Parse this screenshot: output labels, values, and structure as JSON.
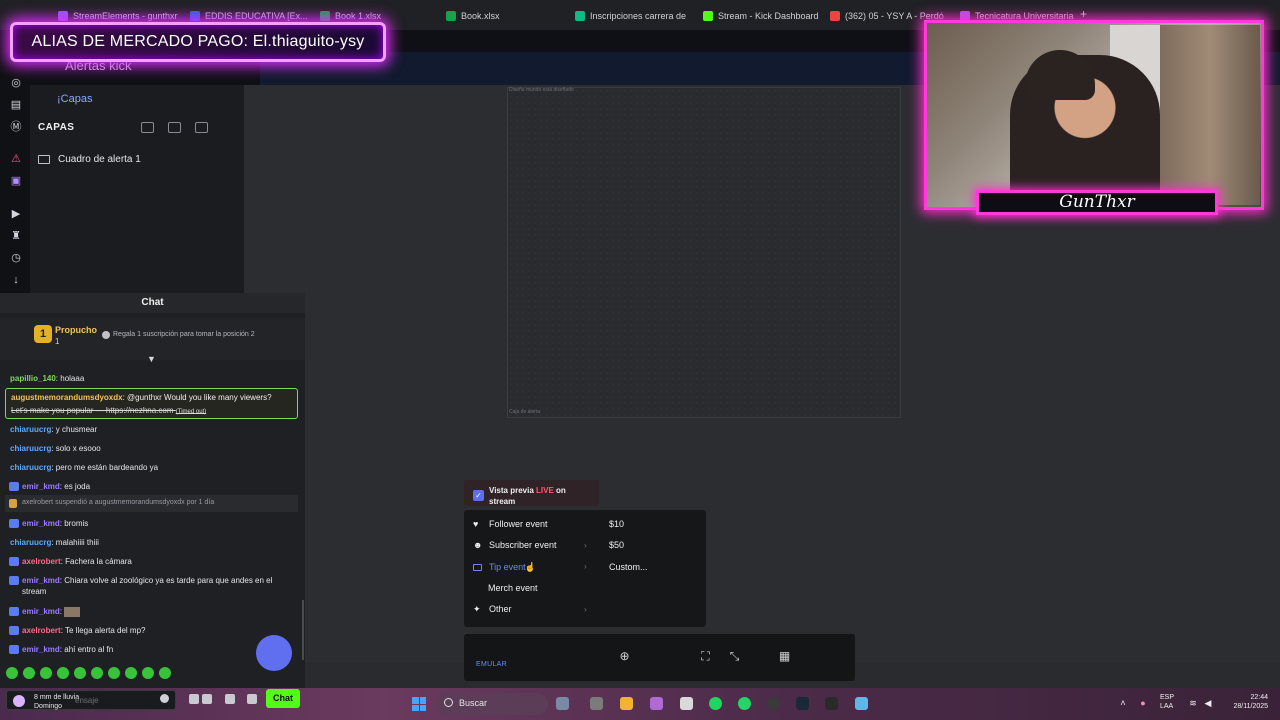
{
  "browser": {
    "tabs": [
      {
        "label": "StreamElements - gunthxr",
        "color": "#8b5cf6"
      },
      {
        "label": "EDDIS EDUCATIVA [Ex...",
        "color": "#2563eb"
      },
      {
        "label": "Book 1.xlsx",
        "color": "#16a34a"
      },
      {
        "label": "Book.xlsx",
        "color": "#16a34a"
      },
      {
        "label": "Inscripciones carrera de",
        "color": "#10b981"
      },
      {
        "label": "Stream - Kick Dashboard",
        "color": "#53fc18"
      },
      {
        "label": "(362) 05 - YSY A - Perdó",
        "color": "#ef4444"
      },
      {
        "label": "Tecnicatura Universitaria",
        "color": "#a855f7"
      }
    ],
    "new_tab": "+"
  },
  "overlay": {
    "banner": "ALIAS DE MERCADO PAGO: El.thiaguito-ysy",
    "streamer_name": "GunThxr"
  },
  "editor": {
    "title": "Alertas kick",
    "breadcrumb": "¡Capas",
    "layers_heading": "CAPAS",
    "layers": [
      "Cuadro de alerta 1"
    ],
    "artboard_top_label": "Diseño mundo está diseñado",
    "artboard_bottom_label": "Caja de alerta"
  },
  "chat": {
    "header": "Chat",
    "top_supporter": {
      "rank": "1",
      "name": "Propucho",
      "count": "1",
      "note": "Regala 1 suscripción para tomar la posición 2"
    },
    "messages": [
      {
        "user": "papillio_140",
        "text": "holaaa",
        "user_color": "#7fd85a",
        "badge": false
      },
      {
        "user": "chiaruucrg",
        "text": "y chusmear",
        "user_color": "#5da9ff",
        "badge": false
      },
      {
        "user": "chiaruucrg",
        "text": "solo x esooo",
        "user_color": "#5da9ff",
        "badge": false
      },
      {
        "user": "chiaruucrg",
        "text": "pero me están bardeando ya",
        "user_color": "#5da9ff",
        "badge": false
      },
      {
        "user": "emir_kmd",
        "text": "es joda",
        "user_color": "#9b7bff",
        "badge": true
      },
      {
        "user": "emir_kmd",
        "text": "bromis",
        "user_color": "#9b7bff",
        "badge": true
      },
      {
        "user": "chiaruucrg",
        "text": "malahiiii thiii",
        "user_color": "#5da9ff",
        "badge": false
      },
      {
        "user": "axelrobert",
        "text": "Fachera la cámara",
        "user_color": "#ff6b8b",
        "badge": true
      },
      {
        "user": "emir_kmd",
        "text": "Chiara volve al zoológico ya es tarde para que andes en el stream",
        "user_color": "#9b7bff",
        "badge": true
      },
      {
        "user": "emir_kmd",
        "text": "",
        "user_color": "#9b7bff",
        "badge": true
      },
      {
        "user": "axelrobert",
        "text": "Te llega alerta del mp?",
        "user_color": "#ff6b8b",
        "badge": true
      },
      {
        "user": "emir_kmd",
        "text": "ahí entro al fn",
        "user_color": "#9b7bff",
        "badge": true
      }
    ],
    "highlight": {
      "user": "augustmemorandumsdyoxdx",
      "text": "@gunthxr Would you like many viewers?",
      "text2": "Let's make you popular — https://nezhna.com",
      "tag": "(Timed out)"
    },
    "system": "axelrobert suspendió a augustmemorandumsdyoxdx por 1 día",
    "input_placeholder": "ensaje",
    "weather_line1": "8 mm de lluvia",
    "weather_line2": "Domingo",
    "send_label": "Chat"
  },
  "preview": {
    "label_a": "Vista previa ",
    "label_live": "LIVE",
    "label_b": " on stream",
    "checked": true
  },
  "menu": {
    "items": [
      {
        "label": "Follower event",
        "icon": "heart-icon",
        "has_submenu": false
      },
      {
        "label": "Subscriber event",
        "icon": "user-plus-icon",
        "has_submenu": true
      },
      {
        "label": "Tip event",
        "icon": "card-icon",
        "has_submenu": true,
        "active": true
      },
      {
        "label": "Merch event",
        "icon": "",
        "has_submenu": false
      },
      {
        "label": "Other",
        "icon": "sparkle-icon",
        "has_submenu": true
      }
    ],
    "submenu": [
      "$10",
      "$50",
      "Custom..."
    ]
  },
  "toolbar": {
    "emulate": "EMULAR"
  },
  "taskbar": {
    "search": "Buscar",
    "lang1": "ESP",
    "lang2": "LAA",
    "time": "22:44",
    "date": "28/11/2025"
  }
}
